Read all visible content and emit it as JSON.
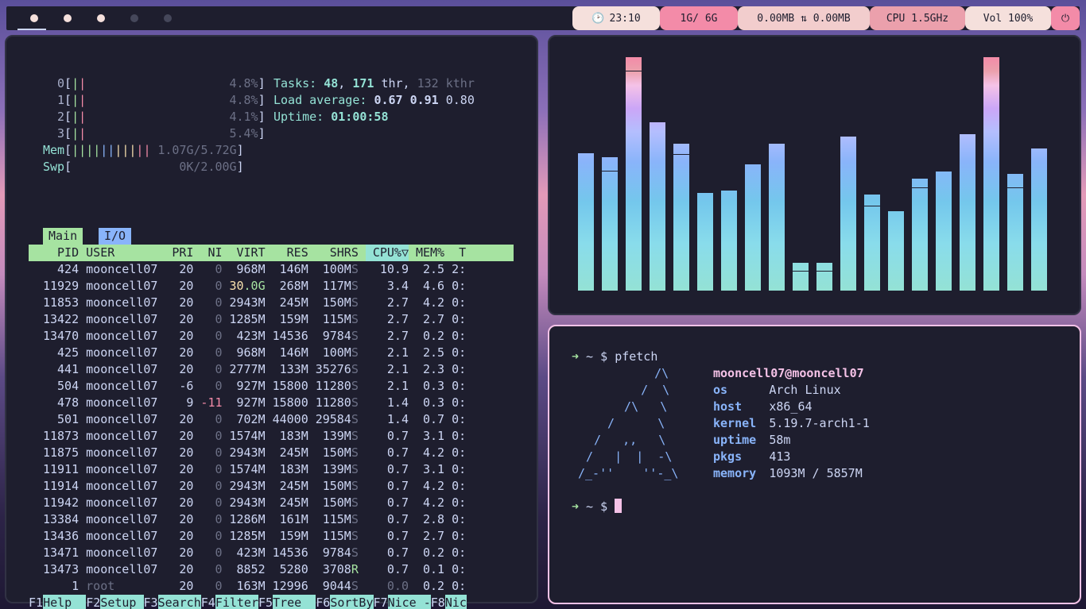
{
  "bar": {
    "workspaces": [
      {
        "state": "active"
      },
      {
        "state": "occupied"
      },
      {
        "state": "occupied"
      },
      {
        "state": "empty"
      },
      {
        "state": "empty"
      }
    ],
    "modules": [
      {
        "icon": "clock-icon",
        "glyph": "🕑",
        "text": "23:10",
        "color": "#f5e0dc"
      },
      {
        "icon": "memory-icon",
        "glyph": "",
        "text": "1G/ 6G",
        "color": "#f38ba8"
      },
      {
        "icon": "network-icon",
        "glyph": "",
        "text": "0.00MB ⇅ 0.00MB",
        "color": "#f2cdcd"
      },
      {
        "icon": "cpu-icon",
        "glyph": "",
        "text": "CPU 1.5GHz",
        "color": "#eba0ac"
      },
      {
        "icon": "volume-icon",
        "glyph": "",
        "text": "Vol 100%",
        "color": "#f5e0dc"
      },
      {
        "icon": "power-icon",
        "glyph": "⏻",
        "text": "",
        "color": "#f38ba8"
      }
    ]
  },
  "htop": {
    "cpus": [
      {
        "id": "0",
        "bar": "||",
        "pct": "4.8%"
      },
      {
        "id": "1",
        "bar": "||",
        "pct": "4.8%"
      },
      {
        "id": "2",
        "bar": "||",
        "pct": "4.1%"
      },
      {
        "id": "3",
        "bar": "||",
        "pct": "5.4%"
      }
    ],
    "mem": {
      "label": "Mem",
      "bar": "|||||||||||",
      "value": "1.07G/5.72G"
    },
    "swp": {
      "label": "Swp",
      "value": "0K/2.00G"
    },
    "tasks": {
      "label": "Tasks:",
      "count": "48",
      "thr": "171",
      "thr_label": "thr,",
      "kthr": "132",
      "kthr_label": "kthr"
    },
    "load": {
      "label": "Load average:",
      "v1": "0.67",
      "v2": "0.91",
      "v3": "0.80"
    },
    "uptime": {
      "label": "Uptime:",
      "value": "01:00:58"
    },
    "tabs": [
      "Main",
      "I/O"
    ],
    "columns": [
      "PID",
      "USER",
      "PRI",
      "NI",
      "VIRT",
      "RES",
      "SHR",
      "S",
      "CPU%▽",
      "MEM%",
      "T"
    ],
    "processes": [
      [
        "424",
        "mooncell07",
        "20",
        "0",
        "968M",
        "146M",
        "100M",
        "S",
        "10.9",
        "2.5",
        "2:"
      ],
      [
        "11929",
        "mooncell07",
        "20",
        "0",
        "30.0G",
        "268M",
        "117M",
        "S",
        "3.4",
        "4.6",
        "0:"
      ],
      [
        "11853",
        "mooncell07",
        "20",
        "0",
        "2943M",
        "245M",
        "150M",
        "S",
        "2.7",
        "4.2",
        "0:"
      ],
      [
        "13422",
        "mooncell07",
        "20",
        "0",
        "1285M",
        "159M",
        "115M",
        "S",
        "2.7",
        "2.7",
        "0:"
      ],
      [
        "13470",
        "mooncell07",
        "20",
        "0",
        "423M",
        "14536",
        "9784",
        "S",
        "2.7",
        "0.2",
        "0:"
      ],
      [
        "425",
        "mooncell07",
        "20",
        "0",
        "968M",
        "146M",
        "100M",
        "S",
        "2.1",
        "2.5",
        "0:"
      ],
      [
        "441",
        "mooncell07",
        "20",
        "0",
        "2777M",
        "133M",
        "35276",
        "S",
        "2.1",
        "2.3",
        "0:"
      ],
      [
        "504",
        "mooncell07",
        "-6",
        "0",
        "927M",
        "15800",
        "11280",
        "S",
        "2.1",
        "0.3",
        "0:"
      ],
      [
        "478",
        "mooncell07",
        "9",
        "-11",
        "927M",
        "15800",
        "11280",
        "S",
        "1.4",
        "0.3",
        "0:"
      ],
      [
        "501",
        "mooncell07",
        "20",
        "0",
        "702M",
        "44000",
        "29584",
        "S",
        "1.4",
        "0.7",
        "0:"
      ],
      [
        "11873",
        "mooncell07",
        "20",
        "0",
        "1574M",
        "183M",
        "139M",
        "S",
        "0.7",
        "3.1",
        "0:"
      ],
      [
        "11875",
        "mooncell07",
        "20",
        "0",
        "2943M",
        "245M",
        "150M",
        "S",
        "0.7",
        "4.2",
        "0:"
      ],
      [
        "11911",
        "mooncell07",
        "20",
        "0",
        "1574M",
        "183M",
        "139M",
        "S",
        "0.7",
        "3.1",
        "0:"
      ],
      [
        "11914",
        "mooncell07",
        "20",
        "0",
        "2943M",
        "245M",
        "150M",
        "S",
        "0.7",
        "4.2",
        "0:"
      ],
      [
        "11942",
        "mooncell07",
        "20",
        "0",
        "2943M",
        "245M",
        "150M",
        "S",
        "0.7",
        "4.2",
        "0:"
      ],
      [
        "13384",
        "mooncell07",
        "20",
        "0",
        "1286M",
        "161M",
        "115M",
        "S",
        "0.7",
        "2.8",
        "0:"
      ],
      [
        "13436",
        "mooncell07",
        "20",
        "0",
        "1285M",
        "159M",
        "115M",
        "S",
        "0.7",
        "2.7",
        "0:"
      ],
      [
        "13471",
        "mooncell07",
        "20",
        "0",
        "423M",
        "14536",
        "9784",
        "S",
        "0.7",
        "0.2",
        "0:"
      ],
      [
        "13473",
        "mooncell07",
        "20",
        "0",
        "8852",
        "5280",
        "3708",
        "R",
        "0.7",
        "0.1",
        "0:"
      ],
      [
        "1",
        "root",
        "20",
        "0",
        "163M",
        "12996",
        "9044",
        "S",
        "0.0",
        "0.2",
        "0:"
      ]
    ],
    "fkeys": [
      {
        "key": "F1",
        "label": "Help  "
      },
      {
        "key": "F2",
        "label": "Setup "
      },
      {
        "key": "F3",
        "label": "Search"
      },
      {
        "key": "F4",
        "label": "Filter"
      },
      {
        "key": "F5",
        "label": "Tree  "
      },
      {
        "key": "F6",
        "label": "SortBy"
      },
      {
        "key": "F7",
        "label": "Nice -"
      },
      {
        "key": "F8",
        "label": "Nic"
      }
    ]
  },
  "cava": {
    "levels": [
      0.59,
      0.57,
      1.0,
      0.72,
      0.63,
      0.42,
      0.43,
      0.54,
      0.63,
      0.12,
      0.12,
      0.66,
      0.41,
      0.34,
      0.48,
      0.51,
      0.67,
      1.0,
      0.5,
      0.61
    ],
    "peaks": [
      null,
      0.51,
      0.94,
      null,
      0.58,
      null,
      null,
      null,
      null,
      0.08,
      0.08,
      null,
      0.36,
      null,
      0.44,
      null,
      null,
      null,
      0.44,
      null
    ]
  },
  "term": {
    "prompt_arrow": "➜",
    "prompt": " ~ $ ",
    "command": "pfetch",
    "ascii": [
      "    /\\",
      "   /  \\",
      "  /\\   \\",
      " /      \\",
      "/   ,,   \\",
      "/   |  |  -\\",
      "/_-''    ''-_\\"
    ],
    "user": "mooncell07@mooncell07",
    "info": [
      {
        "key": "os",
        "value": "Arch Linux"
      },
      {
        "key": "host",
        "value": "x86_64"
      },
      {
        "key": "kernel",
        "value": "5.19.7-arch1-1"
      },
      {
        "key": "uptime",
        "value": "58m"
      },
      {
        "key": "pkgs",
        "value": "413"
      },
      {
        "key": "memory",
        "value": "1093M / 5857M"
      }
    ]
  }
}
